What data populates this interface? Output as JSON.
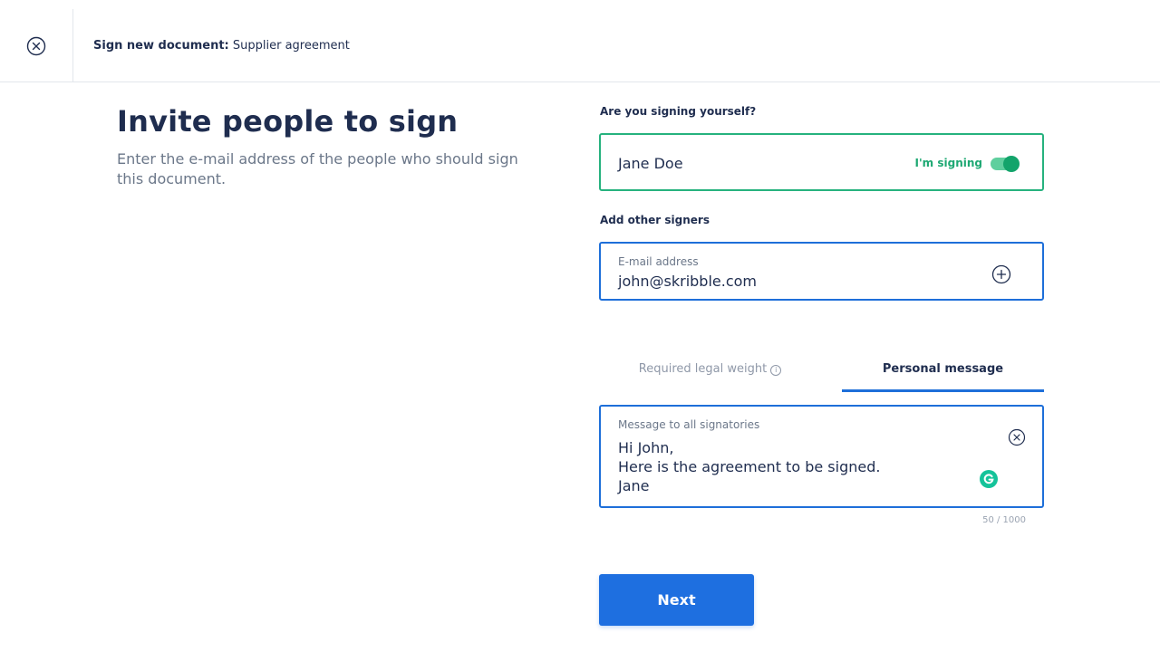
{
  "header": {
    "close_icon": "close-circle-icon",
    "breadcrumb_bold": "Sign new document:",
    "breadcrumb_doc": " Supplier agreement"
  },
  "intro": {
    "title": "Invite people to sign",
    "subtitle": "Enter the e-mail address of the people who should sign this document."
  },
  "self_signing": {
    "label": "Are you signing yourself?",
    "name": "Jane Doe",
    "toggle_label": "I'm signing",
    "toggle_on": true,
    "accent_color": "#26b27e"
  },
  "other_signers": {
    "label": "Add other signers",
    "email_label": "E-mail address",
    "email_value": "john@skribble.com",
    "add_icon": "add-circle-icon"
  },
  "tabs": {
    "legal": "Required legal weight",
    "info_glyph": "i",
    "message": "Personal message",
    "active": "message"
  },
  "message": {
    "label": "Message to all signatories",
    "line1": "Hi John,",
    "line2": "Here is the agreement to be signed.",
    "line3": "Jane",
    "counter": "50 / 1000",
    "clear_icon": "clear-circle-icon",
    "assistant_icon": "grammarly-icon"
  },
  "actions": {
    "next": "Next",
    "primary_color": "#1e6fe0"
  }
}
